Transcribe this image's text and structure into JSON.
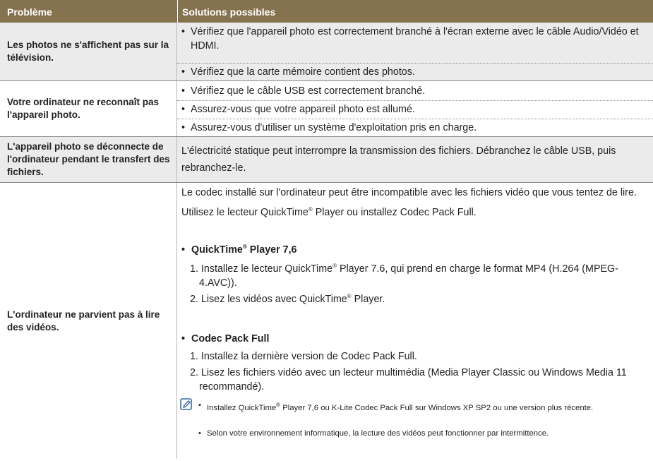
{
  "header": {
    "col1": "Problème",
    "col2": "Solutions possibles"
  },
  "rows": [
    {
      "problem": "Les photos ne s'affichent pas sur la télévision.",
      "solutions": [
        "Vérifiez que l'appareil photo est correctement branché à l'écran externe avec le câble Audio/Vidéo et HDMI.",
        "Vérifiez que la carte mémoire contient des photos."
      ]
    },
    {
      "problem": "Votre ordinateur ne reconnaît pas l'appareil photo.",
      "solutions": [
        "Vérifiez que le câble USB est correctement branché.",
        "Assurez-vous que votre appareil photo est allumé.",
        "Assurez-vous d'utiliser un système d'exploitation pris en charge."
      ]
    },
    {
      "problem": "L'appareil photo se déconnecte de l'ordinateur pendant le transfert des fichiers.",
      "text": "L'électricité statique peut interrompre la transmission des fichiers. Débranchez le câble USB, puis rebranchez-le."
    },
    {
      "problem": "L'ordinateur ne parvient pas à lire des vidéos.",
      "intro": "Le codec installé sur l'ordinateur peut être incompatible avec les fichiers vidéo que vous tentez de lire. Utilisez le lecteur QuickTime® Player ou installez Codec Pack Full.",
      "section1": {
        "title": "QuickTime® Player 7,6",
        "steps": [
          "1. Installez le lecteur QuickTime® Player 7.6, qui prend en charge le format MP4 (H.264 (MPEG-4.AVC)).",
          "2. Lisez les vidéos avec QuickTime® Player."
        ]
      },
      "section2": {
        "title": "Codec Pack Full",
        "steps": [
          "1. Installez la dernière version de Codec Pack Full.",
          "2. Lisez les fichiers vidéo avec un lecteur multimédia (Media Player Classic ou Windows Media 11 recommandé)."
        ]
      },
      "notes": [
        "Installez QuickTime® Player 7,6 ou K-Lite Codec Pack Full sur Windows XP SP2 ou une version plus récente.",
        "Selon votre environnement informatique, la lecture des vidéos peut fonctionner par intermittence."
      ],
      "note_icon": "note-pencil-icon"
    }
  ]
}
